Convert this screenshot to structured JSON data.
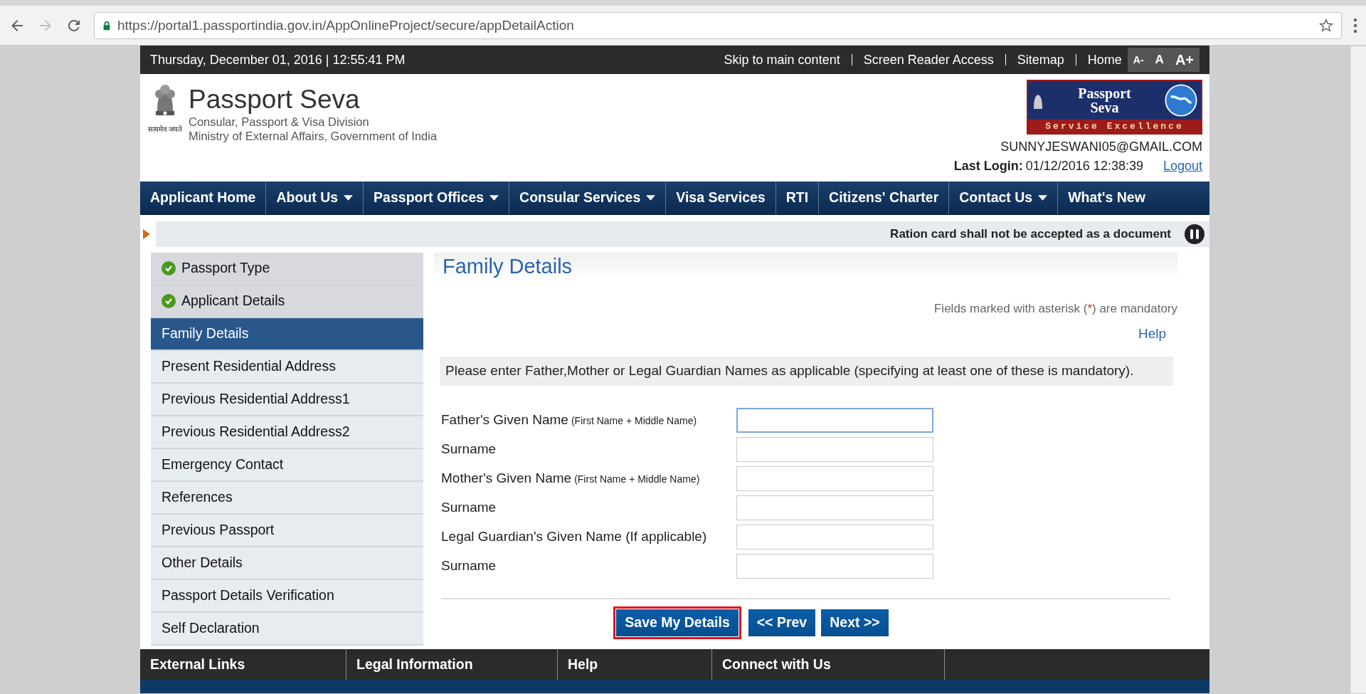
{
  "browser": {
    "url": "https://portal1.passportindia.gov.in/AppOnlineProject/secure/appDetailAction"
  },
  "top_bar": {
    "datetime": "Thursday,  December  01, 2016 | 12:55:41 PM",
    "links": [
      "Skip to main content",
      "Screen Reader Access",
      "Sitemap",
      "Home"
    ],
    "font_sizes": [
      "A-",
      "A",
      "A+"
    ]
  },
  "header": {
    "emblem_caption": "सत्यमेव जयते",
    "title": "Passport Seva",
    "subtitles": [
      "Consular, Passport & Visa Division",
      "Ministry of External Affairs, Government of India"
    ],
    "logo": {
      "title_lines": [
        "Passport",
        "Seva"
      ],
      "tagline": "Service Excellence"
    },
    "user": "SUNNYJESWANI05@GMAIL.COM",
    "last_login_label": "Last Login:",
    "last_login": "01/12/2016 12:38:39",
    "logout": "Logout"
  },
  "nav": [
    {
      "label": "Applicant Home",
      "dropdown": false
    },
    {
      "label": "About Us",
      "dropdown": true
    },
    {
      "label": "Passport Offices",
      "dropdown": true
    },
    {
      "label": "Consular Services",
      "dropdown": true
    },
    {
      "label": "Visa Services",
      "dropdown": false
    },
    {
      "label": "RTI",
      "dropdown": false
    },
    {
      "label": "Citizens' Charter",
      "dropdown": false
    },
    {
      "label": "Contact Us",
      "dropdown": true
    },
    {
      "label": "What's New",
      "dropdown": false
    }
  ],
  "ticker": {
    "text": "Ration card shall not be accepted as a document"
  },
  "sidebar": {
    "items": [
      {
        "label": "Passport Type",
        "completed": true,
        "selected": false
      },
      {
        "label": "Applicant Details",
        "completed": true,
        "selected": false
      },
      {
        "label": "Family Details",
        "completed": false,
        "selected": true
      },
      {
        "label": "Present Residential Address",
        "completed": false,
        "selected": false
      },
      {
        "label": "Previous Residential Address1",
        "completed": false,
        "selected": false
      },
      {
        "label": "Previous Residential Address2",
        "completed": false,
        "selected": false
      },
      {
        "label": "Emergency Contact",
        "completed": false,
        "selected": false
      },
      {
        "label": "References",
        "completed": false,
        "selected": false
      },
      {
        "label": "Previous Passport",
        "completed": false,
        "selected": false
      },
      {
        "label": "Other Details",
        "completed": false,
        "selected": false
      },
      {
        "label": "Passport Details Verification",
        "completed": false,
        "selected": false
      },
      {
        "label": "Self Declaration",
        "completed": false,
        "selected": false
      }
    ]
  },
  "form": {
    "title": "Family Details",
    "mandatory_note": [
      "Fields marked with asterisk (",
      "*",
      ") are mandatory"
    ],
    "help": "Help",
    "instruction": "Please enter Father,Mother or Legal Guardian Names as applicable (specifying at least one of these is mandatory).",
    "fields": [
      {
        "label": "Father's Given Name",
        "hint": "(First Name + Middle Name)",
        "focused": true
      },
      {
        "label": "Surname",
        "focused": false
      },
      {
        "label": "Mother's Given Name",
        "hint": "(First Name + Middle Name)",
        "focused": false
      },
      {
        "label": "Surname",
        "focused": false
      },
      {
        "label": "Legal Guardian's Given Name (If applicable)",
        "focused": false
      },
      {
        "label": "Surname",
        "focused": false
      }
    ],
    "buttons": [
      {
        "label": "Save My Details",
        "highlighted": true
      },
      {
        "label": "<< Prev",
        "highlighted": false
      },
      {
        "label": "Next >>",
        "highlighted": false
      }
    ]
  },
  "footer": {
    "columns": [
      "External Links",
      "Legal Information",
      "Help",
      "Connect with Us"
    ]
  }
}
